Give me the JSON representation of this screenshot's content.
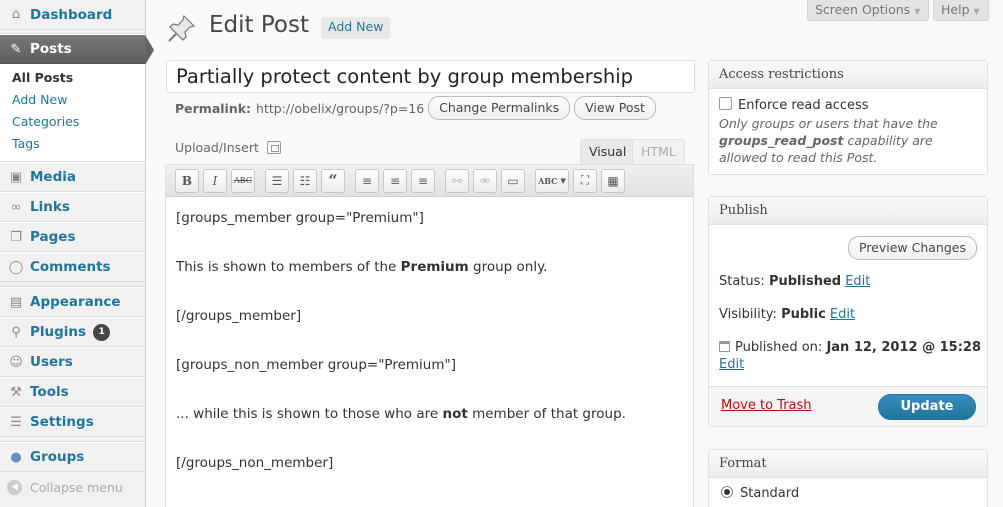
{
  "menu": {
    "dashboard": "Dashboard",
    "posts": "Posts",
    "posts_sub": [
      "All Posts",
      "Add New",
      "Categories",
      "Tags"
    ],
    "media": "Media",
    "links": "Links",
    "pages": "Pages",
    "comments": "Comments",
    "appearance": "Appearance",
    "plugins": "Plugins",
    "plugins_badge": "1",
    "users": "Users",
    "tools": "Tools",
    "settings": "Settings",
    "groups": "Groups",
    "collapse": "Collapse menu"
  },
  "screen_meta": {
    "screen_options": "Screen Options",
    "help": "Help"
  },
  "header": {
    "title": "Edit Post",
    "add_new": "Add New"
  },
  "post": {
    "title": "Partially protect content by group membership",
    "permalink_label": "Permalink:",
    "permalink_url": "http://obelix/groups/?p=16",
    "change_permalinks": "Change Permalinks",
    "view_post": "View Post"
  },
  "editor": {
    "upload_insert": "Upload/Insert",
    "tab_visual": "Visual",
    "tab_html": "HTML",
    "lines": [
      {
        "pre": "[groups_member group=\"Premium\"]",
        "bold": "",
        "post": ""
      },
      {
        "pre": "This is shown to members of the ",
        "bold": "Premium",
        "post": " group only."
      },
      {
        "pre": "[/groups_member]",
        "bold": "",
        "post": ""
      },
      {
        "pre": "[groups_non_member group=\"Premium\"]",
        "bold": "",
        "post": ""
      },
      {
        "pre": "... while this is shown to those who are ",
        "bold": "not",
        "post": " member of that group."
      },
      {
        "pre": "[/groups_non_member]",
        "bold": "",
        "post": ""
      }
    ]
  },
  "access": {
    "title": "Access restrictions",
    "checkbox_label": "Enforce read access",
    "desc_pre": "Only groups or users that have the ",
    "desc_cap": "groups_read_post",
    "desc_post": " capability are allowed to read this Post."
  },
  "publish": {
    "title": "Publish",
    "preview": "Preview Changes",
    "status_label": "Status:",
    "status_value": "Published",
    "visibility_label": "Visibility:",
    "visibility_value": "Public",
    "edit": "Edit",
    "published_on_label": "Published on:",
    "published_on_value": "Jan 12, 2012 @ 15:28",
    "trash": "Move to Trash",
    "update": "Update"
  },
  "format": {
    "title": "Format",
    "standard": "Standard"
  }
}
